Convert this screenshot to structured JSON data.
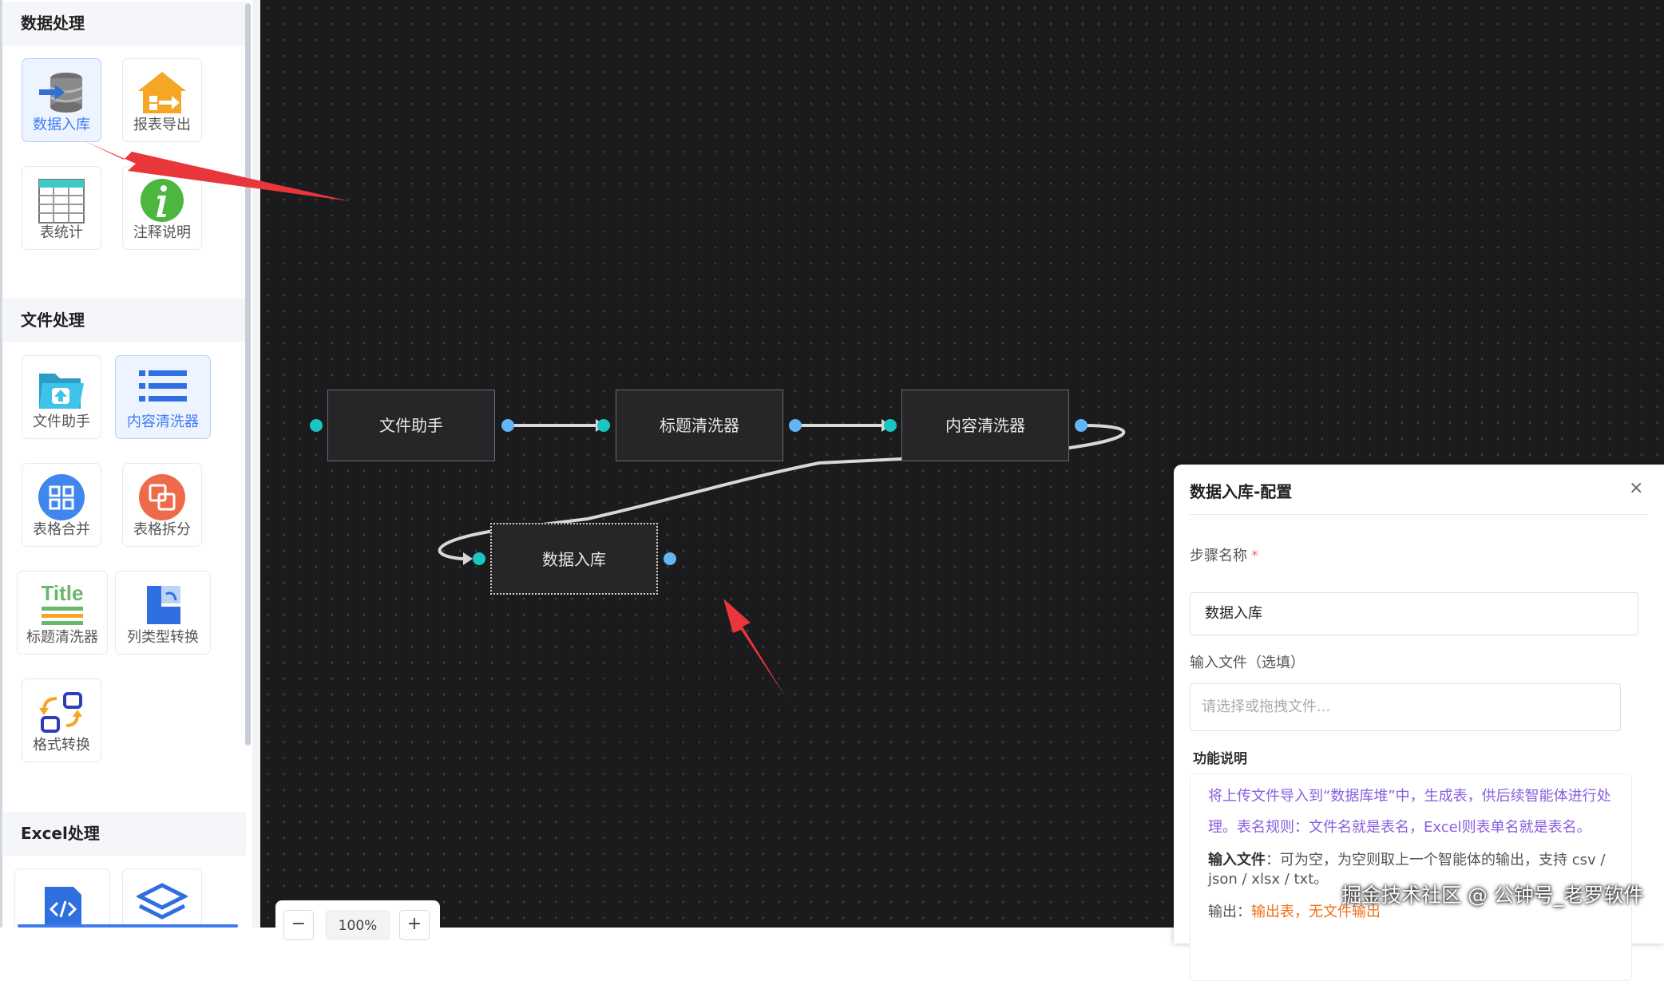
{
  "sidebar": {
    "sections": [
      {
        "title": "数据处理"
      },
      {
        "title": "文件处理"
      },
      {
        "title": "Excel处理"
      }
    ],
    "tools": {
      "data_import": "数据入库",
      "report_export": "报表导出",
      "table_stats": "表统计",
      "annotation": "注释说明",
      "file_helper": "文件助手",
      "content_cleaner": "内容清洗器",
      "table_merge": "表格合并",
      "table_split": "表格拆分",
      "title_cleaner": "标题清洗器",
      "column_type_convert": "列类型转换",
      "format_convert": "格式转换"
    },
    "title_icon_text": "Title"
  },
  "canvas": {
    "nodes": [
      "文件助手",
      "标题清洗器",
      "内容清洗器",
      "数据入库"
    ],
    "zoom": "100%",
    "zoom_out": "−",
    "zoom_in": "+"
  },
  "config": {
    "title": "数据入库-配置",
    "close": "×",
    "step_name_label": "步骤名称",
    "required_mark": "*",
    "step_name_value": "数据入库",
    "input_file_label": "输入文件（选填）",
    "input_file_placeholder": "请选择或拖拽文件...",
    "function_section": "功能说明",
    "description": "将上传文件导入到“数据库堆”中，生成表，供后续智能体进行处理。表名规则：文件名就是表名，Excel则表单名就是表名。",
    "input_desc_label": "输入文件",
    "input_desc_text": "：可为空，为空则取上一个智能体的输出，支持 csv / json / xlsx / txt。",
    "output_label": "输出：",
    "output_value1": "输出表",
    "output_value2": "，无文件输出"
  },
  "watermark": "掘金技术社区 @ 公钟号_老罗软件",
  "colors": {
    "accent": "#3d7bf0",
    "canvas_bg": "#1b1b1d",
    "port_in": "#19c6c0",
    "port_out": "#63b5f5",
    "arrow": "#e8363a"
  }
}
